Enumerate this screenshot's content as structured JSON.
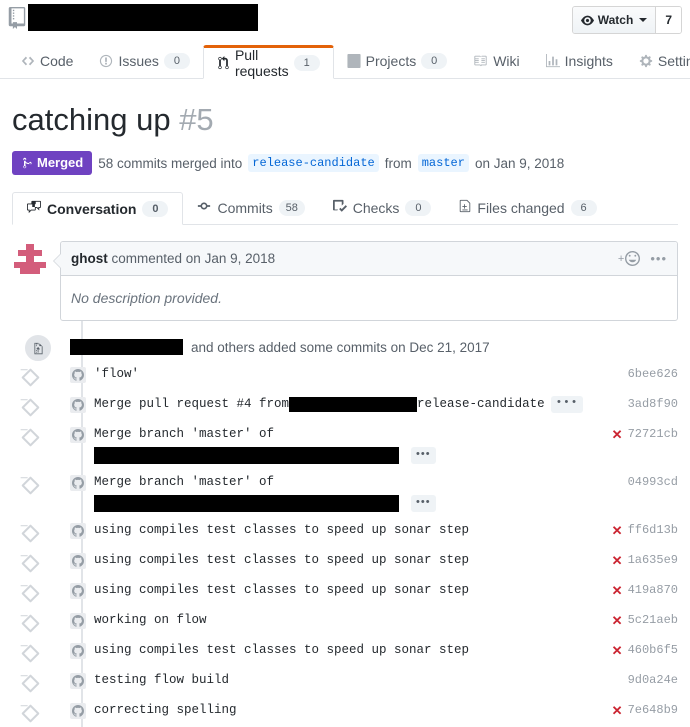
{
  "repo_header": {
    "book_icon": "repo-book-icon",
    "repo_name_redacted": true,
    "watch_label": "Watch",
    "watch_count": "7",
    "watch_icon": "eye-icon"
  },
  "repo_nav": {
    "tabs": [
      {
        "label": "Code",
        "icon": "code-icon",
        "count": null,
        "selected": false
      },
      {
        "label": "Issues",
        "icon": "issue-opened-icon",
        "count": "0",
        "selected": false
      },
      {
        "label": "Pull requests",
        "icon": "git-pull-request-icon",
        "count": "1",
        "selected": true
      },
      {
        "label": "Projects",
        "icon": "project-icon",
        "count": "0",
        "selected": false
      },
      {
        "label": "Wiki",
        "icon": "book-icon",
        "count": null,
        "selected": false
      },
      {
        "label": "Insights",
        "icon": "graph-icon",
        "count": null,
        "selected": false
      },
      {
        "label": "Settings",
        "icon": "gear-icon",
        "count": null,
        "selected": false
      }
    ]
  },
  "pull_request": {
    "title": "catching up",
    "number": "#5",
    "state": "Merged",
    "state_icon": "git-merge-icon",
    "state_color": "#6f42c1",
    "commits_summary": "58 commits merged into",
    "base_branch": "release-candidate",
    "from_word": "from",
    "head_branch": "master",
    "merged_date": "on Jan 9, 2018",
    "tabs": [
      {
        "label": "Conversation",
        "icon": "comment-discussion-icon",
        "count": "0",
        "selected": true
      },
      {
        "label": "Commits",
        "icon": "git-commit-icon",
        "count": "58",
        "selected": false
      },
      {
        "label": "Checks",
        "icon": "checklist-icon",
        "count": "0",
        "selected": false
      },
      {
        "label": "Files changed",
        "icon": "file-diff-icon",
        "count": "6",
        "selected": false
      }
    ]
  },
  "comment": {
    "author": "ghost",
    "action": "commented on Jan 9, 2018",
    "body": "No description provided.",
    "add_reaction_icon": "smiley-plus-icon",
    "menu_icon": "kebab-horizontal-icon"
  },
  "commits_group": {
    "push_icon": "repo-push-icon",
    "author_redacted": true,
    "head_text": "and others added some commits on Dec 21, 2017",
    "rows": [
      {
        "message": "'flow'",
        "redacted_inline": false,
        "inline_before": "",
        "inline_after": "",
        "second_line_redacted": false,
        "has_ellipsis": false,
        "status": null,
        "sha": "6bee626"
      },
      {
        "message": "",
        "redacted_inline": true,
        "inline_before": "Merge pull request #4 from ",
        "inline_after": "release-candidate",
        "second_line_redacted": false,
        "has_ellipsis": true,
        "status": null,
        "sha": "3ad8f90"
      },
      {
        "message": "Merge branch 'master' of",
        "redacted_inline": false,
        "inline_before": "",
        "inline_after": "",
        "second_line_redacted": true,
        "has_ellipsis": true,
        "status": "failure",
        "sha": "72721cb"
      },
      {
        "message": "Merge branch 'master' of",
        "redacted_inline": false,
        "inline_before": "",
        "inline_after": "",
        "second_line_redacted": true,
        "has_ellipsis": true,
        "status": null,
        "sha": "04993cd"
      },
      {
        "message": "using compiles test classes to speed up sonar step",
        "redacted_inline": false,
        "inline_before": "",
        "inline_after": "",
        "second_line_redacted": false,
        "has_ellipsis": false,
        "status": "failure",
        "sha": "ff6d13b"
      },
      {
        "message": "using compiles test classes to speed up sonar step",
        "redacted_inline": false,
        "inline_before": "",
        "inline_after": "",
        "second_line_redacted": false,
        "has_ellipsis": false,
        "status": "failure",
        "sha": "1a635e9"
      },
      {
        "message": "using compiles test classes to speed up sonar step",
        "redacted_inline": false,
        "inline_before": "",
        "inline_after": "",
        "second_line_redacted": false,
        "has_ellipsis": false,
        "status": "failure",
        "sha": "419a870"
      },
      {
        "message": "working on flow",
        "redacted_inline": false,
        "inline_before": "",
        "inline_after": "",
        "second_line_redacted": false,
        "has_ellipsis": false,
        "status": "failure",
        "sha": "5c21aeb"
      },
      {
        "message": "using compiles test classes to speed up sonar step",
        "redacted_inline": false,
        "inline_before": "",
        "inline_after": "",
        "second_line_redacted": false,
        "has_ellipsis": false,
        "status": "failure",
        "sha": "460b6f5"
      },
      {
        "message": "testing flow build",
        "redacted_inline": false,
        "inline_before": "",
        "inline_after": "",
        "second_line_redacted": false,
        "has_ellipsis": false,
        "status": null,
        "sha": "9d0a24e"
      },
      {
        "message": "correcting spelling",
        "redacted_inline": false,
        "inline_before": "",
        "inline_after": "",
        "second_line_redacted": false,
        "has_ellipsis": false,
        "status": "failure",
        "sha": "7e648b9"
      }
    ],
    "failure_icon": "x-icon",
    "failure_color": "#cb2431"
  }
}
